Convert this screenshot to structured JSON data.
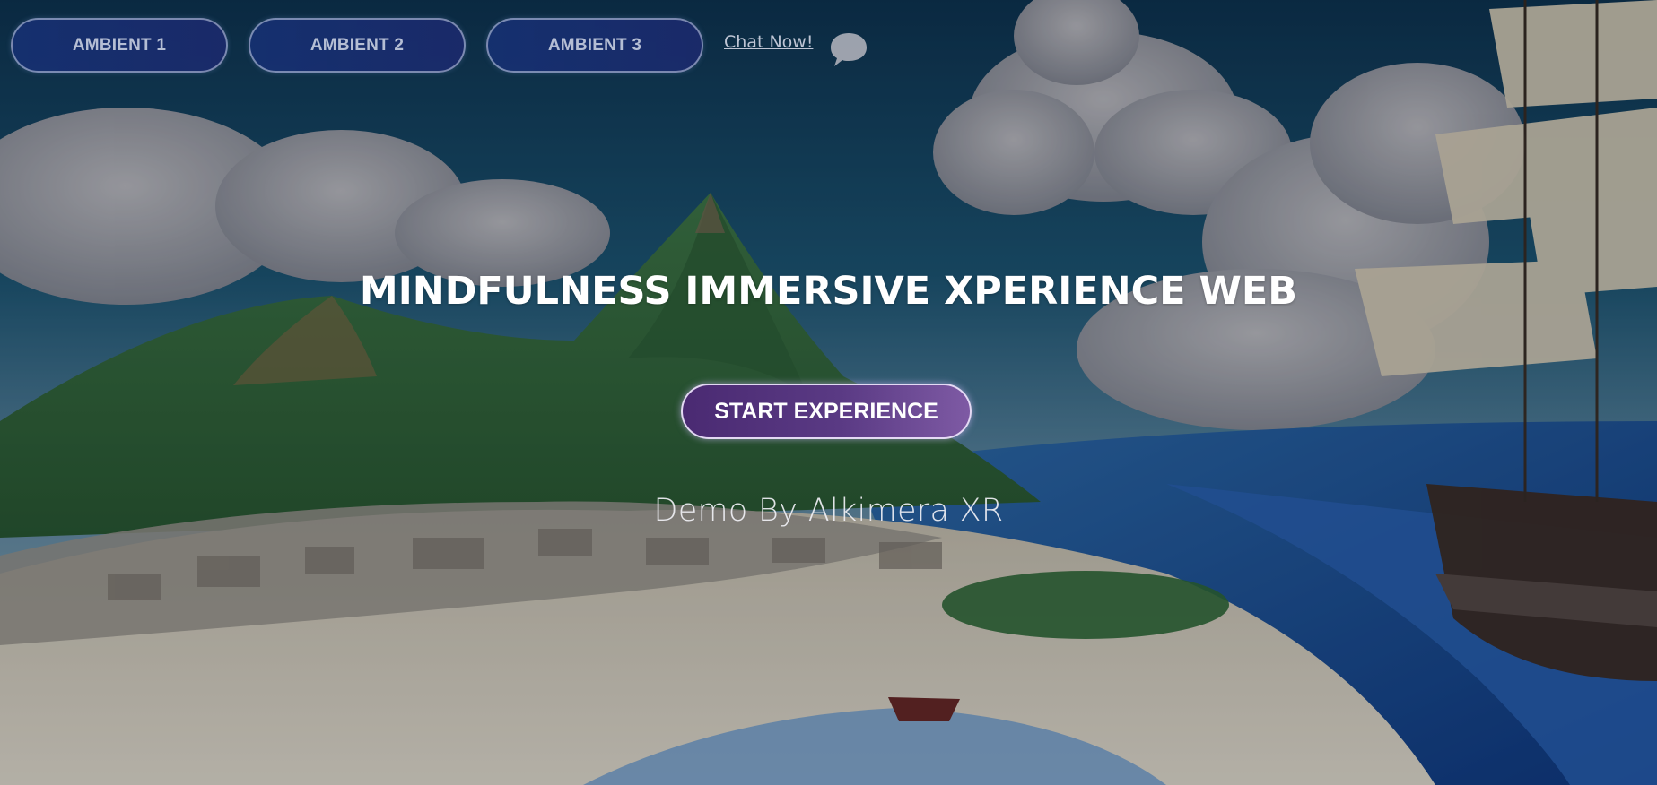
{
  "nav": {
    "ambient_buttons": [
      "AMBIENT 1",
      "AMBIENT 2",
      "AMBIENT 3"
    ],
    "chat_link": "Chat Now!",
    "chat_icon": "speech-bubble-icon"
  },
  "hero": {
    "title": "MINDFULNESS IMMERSIVE XPERIENCE WEB",
    "start_button": "START EXPERIENCE",
    "credit": "Demo By Alkimera XR"
  },
  "colors": {
    "ambient_button_bg": "#1c2f74",
    "start_button_bg": "#5a3a84",
    "title_text": "#ffffff"
  }
}
